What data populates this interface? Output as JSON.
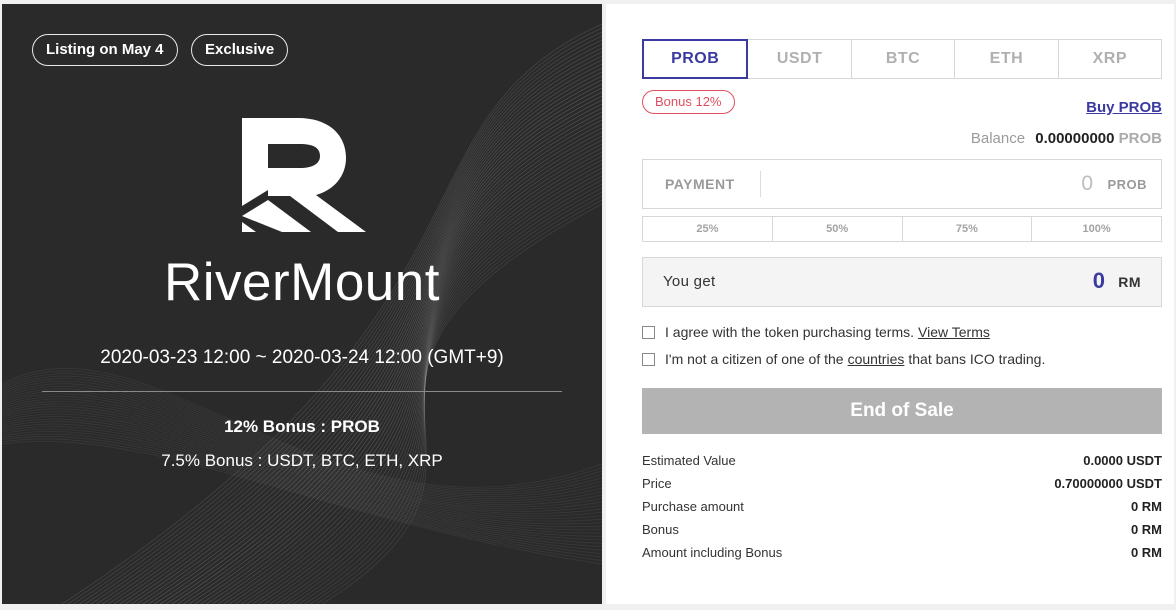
{
  "hero": {
    "badges": [
      "Listing on May 4",
      "Exclusive"
    ],
    "brand_name": "RiverMount",
    "sale_period": "2020-03-23 12:00 ~ 2020-03-24 12:00 (GMT+9)",
    "bonus_primary": "12% Bonus : PROB",
    "bonus_secondary": "7.5% Bonus : USDT, BTC, ETH, XRP",
    "logo_icon": "rivermount-r-logo-icon",
    "background_color": "#2a2a2a"
  },
  "currency_tabs": [
    "PROB",
    "USDT",
    "BTC",
    "ETH",
    "XRP"
  ],
  "active_tab": "PROB",
  "bonus_badge": "Bonus 12%",
  "buy_link": "Buy PROB",
  "balance": {
    "label": "Balance",
    "value": "0.00000000",
    "unit": "PROB"
  },
  "payment": {
    "label": "PAYMENT",
    "value": "0",
    "unit": "PROB"
  },
  "percent_buttons": [
    "25%",
    "50%",
    "75%",
    "100%"
  ],
  "you_get": {
    "label": "You get",
    "value": "0",
    "unit": "RM"
  },
  "agreements": {
    "terms_text": "I agree with the token purchasing terms.",
    "terms_link": "View Terms",
    "citizen_prefix": "I'm not a citizen of one of the",
    "citizen_link": "countries",
    "citizen_suffix": "that bans ICO trading."
  },
  "submit_button": "End of Sale",
  "summary": [
    {
      "label": "Estimated Value",
      "value": "0.0000 USDT"
    },
    {
      "label": "Price",
      "value": "0.70000000 USDT"
    },
    {
      "label": "Purchase amount",
      "value": "0 RM"
    },
    {
      "label": "Bonus",
      "value": "0 RM"
    },
    {
      "label": "Amount including Bonus",
      "value": "0 RM"
    }
  ],
  "colors": {
    "accent": "#3b3aa0",
    "badge_red": "#e04f5f",
    "disabled_button": "#b3b3b3"
  }
}
